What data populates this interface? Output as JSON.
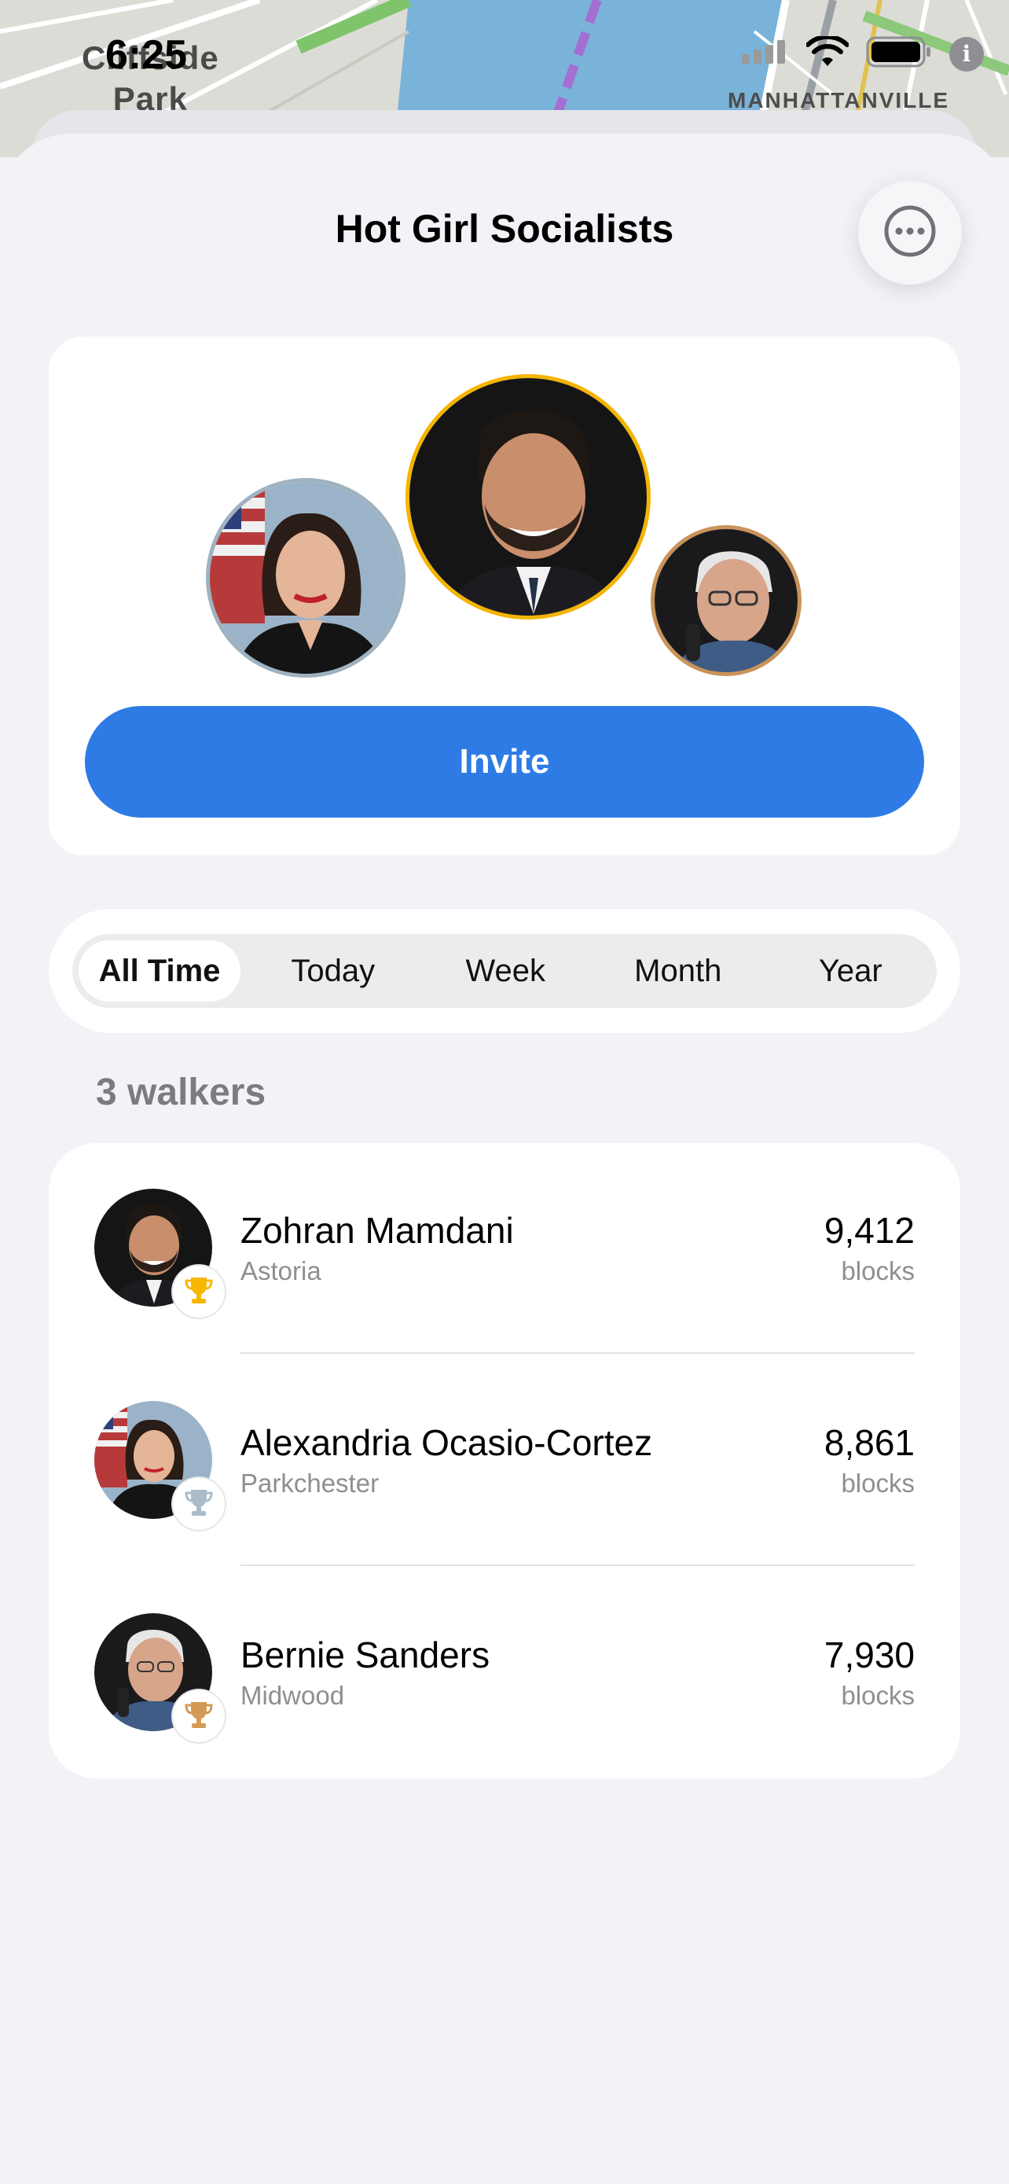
{
  "status_bar": {
    "time": "6:25",
    "info_icon": "i",
    "icons": [
      "signal-icon",
      "wifi-icon",
      "battery-icon",
      "info-icon"
    ]
  },
  "map": {
    "park_label_line1": "Cliffside",
    "park_label_line2": "Park",
    "neighborhood_label": "MANHATTANVILLE"
  },
  "header": {
    "title": "Hot Girl Socialists",
    "more_icon": "ellipsis-circle-icon"
  },
  "group_card": {
    "invite_label": "Invite"
  },
  "range_tabs": {
    "items": [
      "All Time",
      "Today",
      "Week",
      "Month",
      "Year"
    ],
    "selected": "All Time"
  },
  "walkers": {
    "count_label": "3 walkers",
    "unit_label": "blocks",
    "rows": [
      {
        "name": "Zohran Mamdani",
        "place": "Astoria",
        "value": "9,412",
        "trophy": "gold",
        "trophy_color": "#f6b800"
      },
      {
        "name": "Alexandria Ocasio-Cortez",
        "place": "Parkchester",
        "value": "8,861",
        "trophy": "silver",
        "trophy_color": "#a9bcc8"
      },
      {
        "name": "Bernie Sanders",
        "place": "Midwood",
        "value": "7,930",
        "trophy": "bronze",
        "trophy_color": "#d39a55"
      }
    ]
  },
  "colors": {
    "accent": "#2e7be6",
    "background": "#f2f2f7",
    "gold_ring": "#f4b400",
    "silver_ring": "#9fb2c0",
    "bronze_ring": "#c9935a"
  }
}
